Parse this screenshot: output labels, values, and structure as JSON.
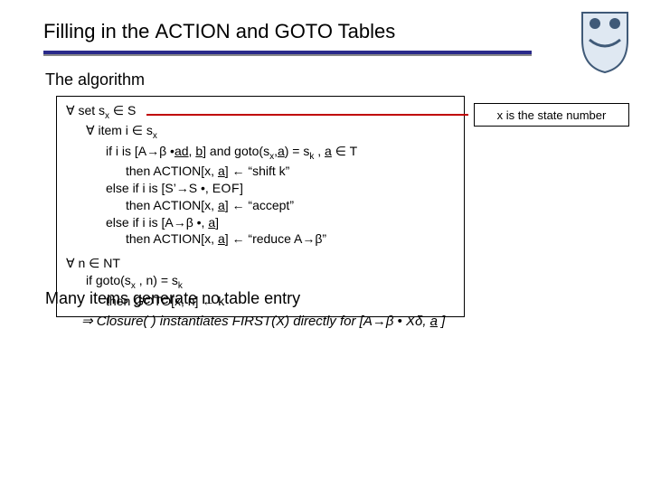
{
  "title": {
    "pre": "Filling in the ",
    "w1": "ACTION",
    "mid": " and ",
    "w2": "GOTO",
    "post": " Tables"
  },
  "subheading": "The algorithm",
  "algo": {
    "l1a": "∀ set s",
    "l1b": "x",
    "l1c": " ∈ S",
    "l2a": "∀ item i ∈  s",
    "l2b": "x",
    "l3a": "if  i is [A→β •",
    "l3a_ul": "ad",
    "l3a2": ", ",
    "l3a_ul2": "b",
    "l3a3": "] and goto(s",
    "l3a_sub": "x",
    "l3a4": ",",
    "l3a_ul3": "a",
    "l3a5": ") = s",
    "l3a_sub2": "k",
    "l3a6": " , ",
    "l3a_ul4": "a",
    "l3a7": " ∈  T",
    "l4a": "then ACTION[x, ",
    "l4a_ul": "a",
    "l4a2": "] ← “shift k”",
    "l3b": "else if  i is [S’→S •, ",
    "l3b_sc": "EOF",
    "l3b2": "]",
    "l4b": "then ACTION[x, ",
    "l4b_ul": "a",
    "l4b2": "] ← “accept”",
    "l3c": "else if  i is [A→β •, ",
    "l3c_ul": "a",
    "l3c2": "]",
    "l4c": "then ACTION[x, ",
    "l4c_ul": "a",
    "l4c2": "] ← “reduce A→β”",
    "b1": "∀  n ∈  NT",
    "b2a": "if  goto(s",
    "b2_sub": "x",
    "b2b": " , n) = s",
    "b2_sub2": "k",
    "b3": "then GOTO[x, n] ← k"
  },
  "callout": "x is the state number",
  "footer1": "Many items generate no table entry",
  "footer2": {
    "arrow": "⇒",
    "pre": " Closure( ) instantiates FIRST(X) directly for [A→β • Xδ, ",
    "ul": "a",
    "post": " ]"
  }
}
